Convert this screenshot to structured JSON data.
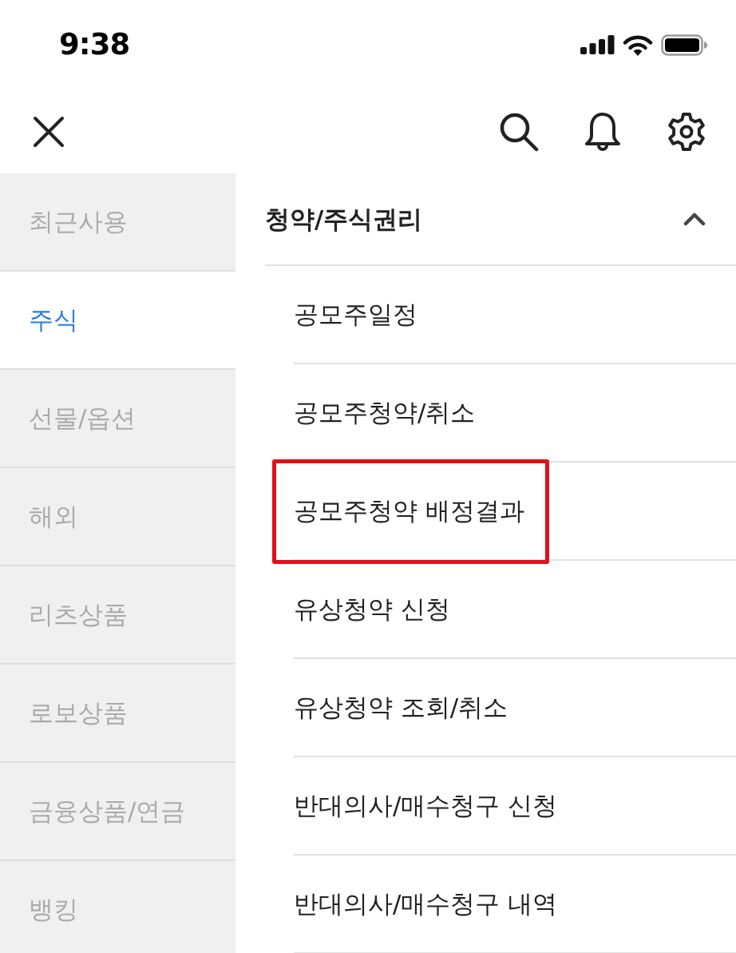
{
  "status_bar": {
    "time": "9:38"
  },
  "sidebar": {
    "items": [
      {
        "label": "최근사용",
        "selected": false
      },
      {
        "label": "주식",
        "selected": true
      },
      {
        "label": "선물/옵션",
        "selected": false
      },
      {
        "label": "해외",
        "selected": false
      },
      {
        "label": "리츠상품",
        "selected": false
      },
      {
        "label": "로보상품",
        "selected": false
      },
      {
        "label": "금융상품/연금",
        "selected": false
      },
      {
        "label": "뱅킹",
        "selected": false
      }
    ]
  },
  "menu": {
    "section": {
      "title": "청약/주식권리",
      "expanded": true
    },
    "items": [
      {
        "label": "공모주일정",
        "highlighted": false
      },
      {
        "label": "공모주청약/취소",
        "highlighted": false
      },
      {
        "label": "공모주청약 배정결과",
        "highlighted": true
      },
      {
        "label": "유상청약 신청",
        "highlighted": false
      },
      {
        "label": "유상청약 조회/취소",
        "highlighted": false
      },
      {
        "label": "반대의사/매수청구 신청",
        "highlighted": false
      },
      {
        "label": "반대의사/매수청구 내역",
        "highlighted": false
      }
    ]
  }
}
